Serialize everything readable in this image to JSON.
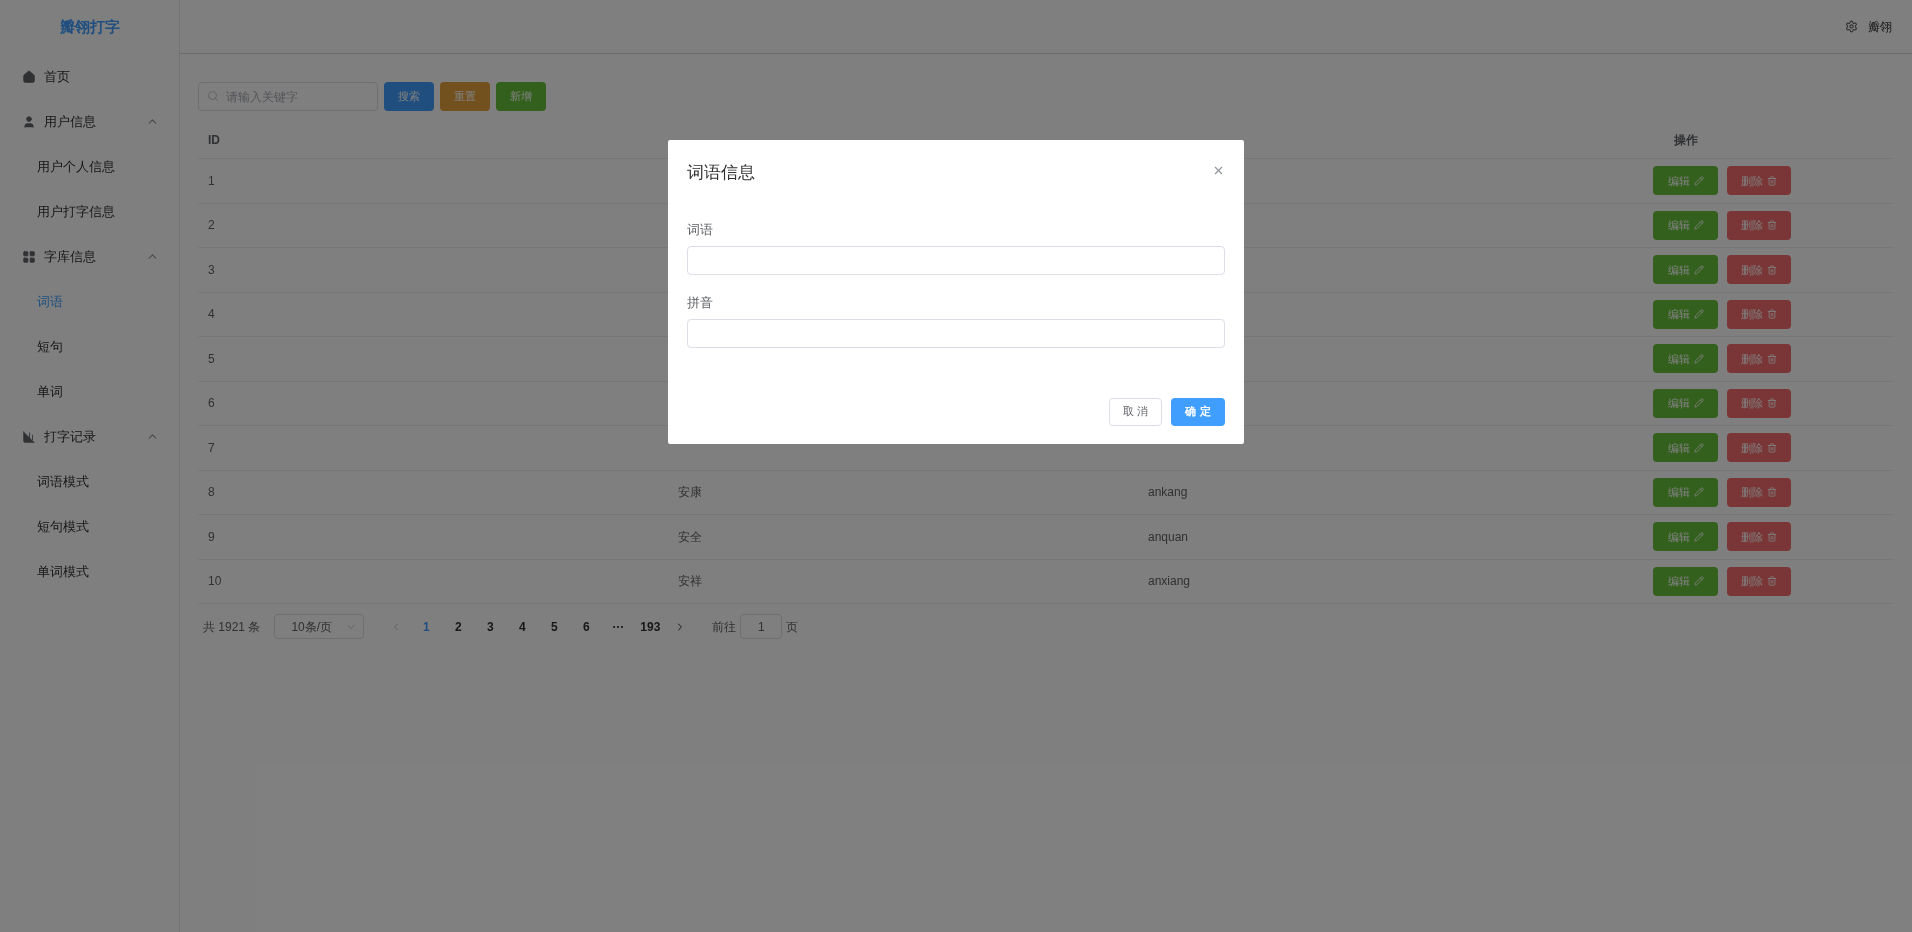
{
  "sidebar": {
    "logo": "瓣翎打字",
    "items": [
      {
        "label": "首页",
        "selected": false
      },
      {
        "label": "用户信息",
        "expanded": true,
        "children": [
          {
            "label": "用户个人信息",
            "selected": false
          },
          {
            "label": "用户打字信息",
            "selected": false
          }
        ]
      },
      {
        "label": "字库信息",
        "expanded": true,
        "children": [
          {
            "label": "词语",
            "selected": true
          },
          {
            "label": "短句",
            "selected": false
          },
          {
            "label": "单词",
            "selected": false
          }
        ]
      },
      {
        "label": "打字记录",
        "expanded": true,
        "children": [
          {
            "label": "词语模式",
            "selected": false
          },
          {
            "label": "短句模式",
            "selected": false
          },
          {
            "label": "单词模式",
            "selected": false
          }
        ]
      }
    ]
  },
  "header": {
    "user": "瓣翎"
  },
  "toolbar": {
    "search": {
      "placeholder": "请输入关键字"
    },
    "buttons": [
      {
        "kind": "search",
        "label": "搜索"
      },
      {
        "kind": "reset",
        "label": "重置"
      },
      {
        "kind": "add",
        "label": "新增"
      }
    ]
  },
  "table": {
    "columns": [
      "ID",
      "操作"
    ],
    "rows": [
      {
        "id": "1",
        "actions": [
          {
            "kind": "edit",
            "label": "编辑"
          },
          {
            "kind": "delete",
            "label": "删除"
          }
        ]
      },
      {
        "id": "2",
        "actions": [
          {
            "kind": "edit",
            "label": "编辑"
          },
          {
            "kind": "delete",
            "label": "删除"
          }
        ]
      },
      {
        "id": "3",
        "actions": [
          {
            "kind": "edit",
            "label": "编辑"
          },
          {
            "kind": "delete",
            "label": "删除"
          }
        ]
      },
      {
        "id": "4",
        "actions": [
          {
            "kind": "edit",
            "label": "编辑"
          },
          {
            "kind": "delete",
            "label": "删除"
          }
        ]
      },
      {
        "id": "5",
        "actions": [
          {
            "kind": "edit",
            "label": "编辑"
          },
          {
            "kind": "delete",
            "label": "删除"
          }
        ]
      },
      {
        "id": "6",
        "actions": [
          {
            "kind": "edit",
            "label": "编辑"
          },
          {
            "kind": "delete",
            "label": "删除"
          }
        ]
      },
      {
        "id": "7",
        "actions": [
          {
            "kind": "edit",
            "label": "编辑"
          },
          {
            "kind": "delete",
            "label": "删除"
          }
        ]
      },
      {
        "id": "8",
        "word": "安康",
        "pinyin": "ankang",
        "actions": [
          {
            "kind": "edit",
            "label": "编辑"
          },
          {
            "kind": "delete",
            "label": "删除"
          }
        ]
      },
      {
        "id": "9",
        "word": "安全",
        "pinyin": "anquan",
        "actions": [
          {
            "kind": "edit",
            "label": "编辑"
          },
          {
            "kind": "delete",
            "label": "删除"
          }
        ]
      },
      {
        "id": "10",
        "word": "安祥",
        "pinyin": "anxiang",
        "actions": [
          {
            "kind": "edit",
            "label": "编辑"
          },
          {
            "kind": "delete",
            "label": "删除"
          }
        ]
      }
    ]
  },
  "pagination": {
    "total": "共 1921 条",
    "page_size": "10条/页",
    "pages": [
      {
        "label": "1",
        "selected": true
      },
      {
        "label": "2",
        "selected": false
      },
      {
        "label": "3",
        "selected": false
      },
      {
        "label": "4",
        "selected": false
      },
      {
        "label": "5",
        "selected": false
      },
      {
        "label": "6",
        "selected": false
      },
      {
        "label": "···",
        "selected": false
      },
      {
        "label": "193",
        "selected": false
      }
    ],
    "goto_label": "前往",
    "goto_value": "1",
    "goto_suffix": "页"
  },
  "dialog": {
    "title": "词语信息",
    "fields": [
      {
        "label": "词语"
      },
      {
        "label": "拼音"
      }
    ],
    "buttons": [
      {
        "kind": "cancel",
        "label": "取 消"
      },
      {
        "kind": "confirm",
        "label": "确 定"
      }
    ]
  }
}
